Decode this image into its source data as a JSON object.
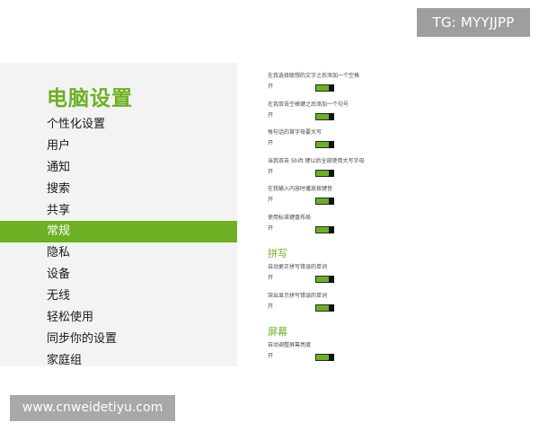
{
  "badge": {
    "text": "TG: MYYJJPP"
  },
  "settings": {
    "title": "电脑设置",
    "nav": [
      {
        "label": "个性化设置"
      },
      {
        "label": "用户"
      },
      {
        "label": "通知"
      },
      {
        "label": "搜索"
      },
      {
        "label": "共享"
      },
      {
        "label": "常规",
        "selected": true
      },
      {
        "label": "隐私"
      },
      {
        "label": "设备"
      },
      {
        "label": "无线"
      },
      {
        "label": "轻松使用"
      },
      {
        "label": "同步你的设置"
      },
      {
        "label": "家庭组"
      }
    ]
  },
  "general": {
    "rows": [
      {
        "label": "在我选择联想的文字之后添加一个空格",
        "state": "开",
        "on": true
      },
      {
        "label": "在我双击空格键之后添加一个句号",
        "state": "开",
        "on": true
      },
      {
        "label": "每句话的首字母要大写",
        "state": "开",
        "on": true
      },
      {
        "label": "当我双击 Shift 键以后全部使用大写字母",
        "state": "开",
        "on": true
      },
      {
        "label": "在我输入内容时播放按键音",
        "state": "开",
        "on": true
      },
      {
        "label": "使用标准键盘布局",
        "state": "开",
        "on": true
      }
    ]
  },
  "spelling": {
    "header": "拼写",
    "rows": [
      {
        "label": "自动更正拼写错误的单词",
        "state": "开",
        "on": true
      },
      {
        "label": "突出显示拼写错误的单词",
        "state": "开",
        "on": true
      }
    ]
  },
  "screen": {
    "header": "屏幕",
    "rows": [
      {
        "label": "自动调整屏幕亮度",
        "state": "开",
        "on": true
      }
    ]
  },
  "watermark": {
    "text": "www.cnweidetiyu.com"
  },
  "colors": {
    "accent": "#6bb123",
    "badge_bg": "#9e9e9e",
    "panel_bg": "#f3f3f3"
  }
}
